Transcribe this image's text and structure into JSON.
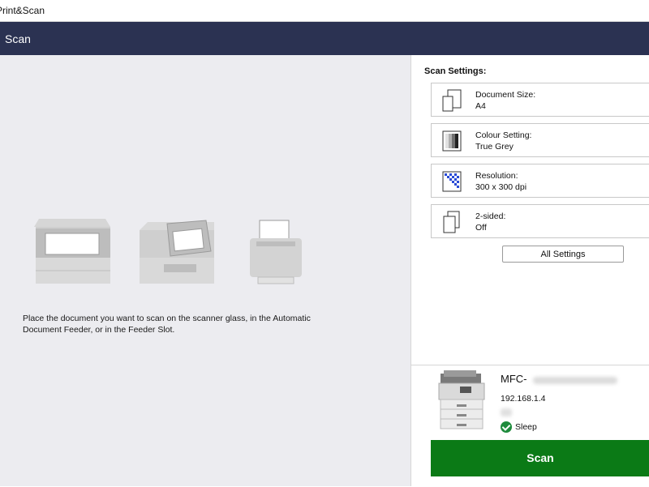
{
  "titlebar": {
    "title": "Print&Scan"
  },
  "header": {
    "title": "Scan"
  },
  "instructions": "Place the document you want to scan on the scanner glass, in the Automatic Document Feeder, or in the Feeder Slot.",
  "illustrations": [
    "flatbed-scanner-icon",
    "document-feeder-icon",
    "feeder-slot-icon"
  ],
  "settings": {
    "title": "Scan Settings:",
    "items": [
      {
        "label": "Document Size:",
        "value": "A4",
        "icon": "document-size-icon"
      },
      {
        "label": "Colour Setting:",
        "value": "True Grey",
        "icon": "colour-setting-icon"
      },
      {
        "label": "Resolution:",
        "value": "300 x 300 dpi",
        "icon": "resolution-icon"
      },
      {
        "label": "2-sided:",
        "value": "Off",
        "icon": "two-sided-icon"
      }
    ],
    "all_settings_label": "All Settings"
  },
  "device": {
    "name": "MFC-",
    "ip": "192.168.1.4",
    "status": "Sleep",
    "status_color": "#1e8b3c"
  },
  "scan_button_label": "Scan",
  "colors": {
    "header": "#2b3252",
    "scan_button": "#0b7a16",
    "left_panel": "#ececf0"
  }
}
